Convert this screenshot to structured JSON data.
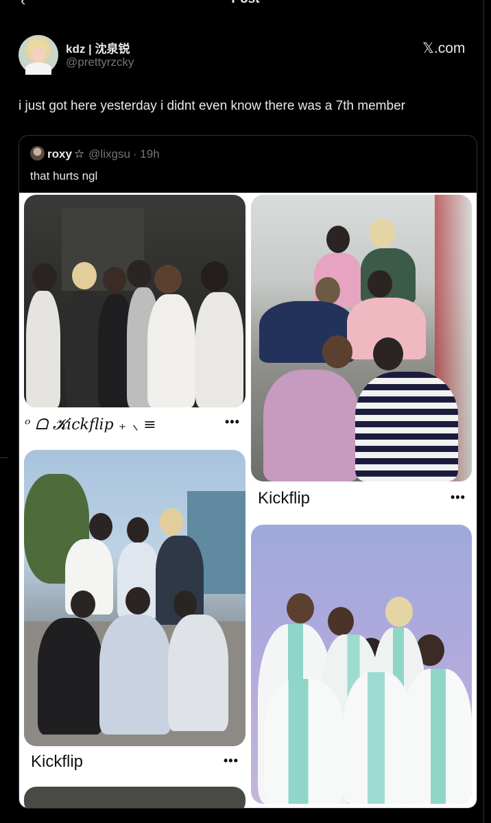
{
  "header": {
    "back_icon": "back-arrow-icon",
    "title": "Post"
  },
  "post": {
    "author_name": "kdz | 沈泉锐",
    "author_handle": "@prettyrzcky",
    "source_label": "𝕏.com",
    "text": "i just got here yesterday i didnt even know there was a 7th member"
  },
  "quote": {
    "name": "roxy",
    "star": "☆",
    "handle": "@lixgsu",
    "time": "· 19h",
    "text": "that hurts ngl"
  },
  "pins": [
    {
      "caption": "ᵒ ᗝ  𝓚ickflip ₊ ⸜ ≡",
      "more": "•••"
    },
    {
      "caption": "Kickflip",
      "more": "•••"
    },
    {
      "caption": "Kickflip",
      "more": "•••"
    }
  ],
  "colors": {
    "background": "#000000",
    "secondary_text": "#71767b",
    "border": "#2f3336"
  }
}
